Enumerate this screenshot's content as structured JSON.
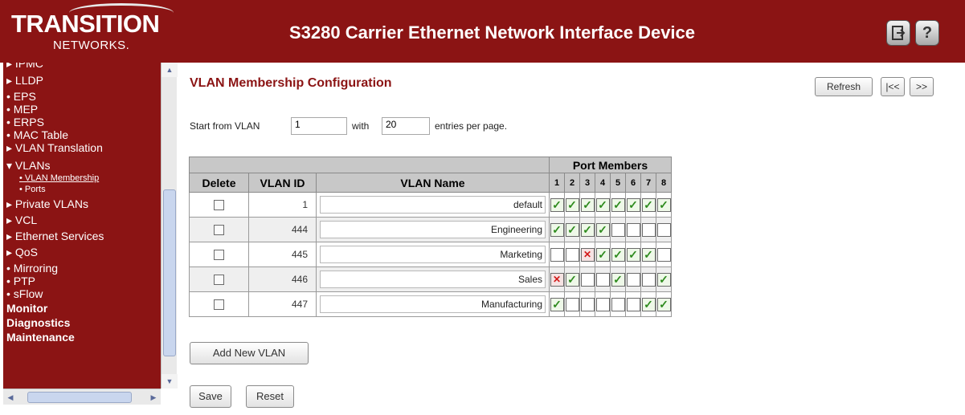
{
  "header": {
    "logo_main": "TRANSITION",
    "logo_sub": "NETWORKS.",
    "title": "S3280 Carrier Ethernet Network Interface Device",
    "logout_icon": "logout-icon",
    "help_label": "?"
  },
  "sidebar": {
    "items": [
      {
        "label": "▸ IPMC",
        "type": "partial"
      },
      {
        "label": "▸ LLDP",
        "type": "collapsed"
      },
      {
        "label": "• EPS",
        "type": "leaf"
      },
      {
        "label": "• MEP",
        "type": "leaf"
      },
      {
        "label": "• ERPS",
        "type": "leaf"
      },
      {
        "label": "• MAC Table",
        "type": "leaf"
      },
      {
        "label": "▸ VLAN Translation",
        "type": "collapsed"
      },
      {
        "label": "▾ VLANs",
        "type": "expanded"
      },
      {
        "label": "• VLAN Membership",
        "type": "sub-active"
      },
      {
        "label": "• Ports",
        "type": "sub"
      },
      {
        "label": "▸ Private VLANs",
        "type": "collapsed"
      },
      {
        "label": "▸ VCL",
        "type": "collapsed"
      },
      {
        "label": "▸ Ethernet Services",
        "type": "collapsed"
      },
      {
        "label": "▸ QoS",
        "type": "collapsed"
      },
      {
        "label": "• Mirroring",
        "type": "leaf"
      },
      {
        "label": "• PTP",
        "type": "leaf"
      },
      {
        "label": "• sFlow",
        "type": "leaf"
      },
      {
        "label": "Monitor",
        "type": "section"
      },
      {
        "label": "Diagnostics",
        "type": "section"
      },
      {
        "label": "Maintenance",
        "type": "section"
      }
    ]
  },
  "page": {
    "title": "VLAN Membership Configuration",
    "refresh_label": "Refresh",
    "first_label": "|<<",
    "next_label": ">>",
    "start_label": "Start from VLAN",
    "start_value": "1",
    "with_label": "with",
    "entries_value": "20",
    "entries_label": "entries per page."
  },
  "table": {
    "port_members_header": "Port Members",
    "col_delete": "Delete",
    "col_vlan_id": "VLAN ID",
    "col_vlan_name": "VLAN Name",
    "ports": [
      "1",
      "2",
      "3",
      "4",
      "5",
      "6",
      "7",
      "8"
    ],
    "rows": [
      {
        "id": "1",
        "name": "default",
        "ports": [
          "member",
          "member",
          "member",
          "member",
          "member",
          "member",
          "member",
          "member"
        ]
      },
      {
        "id": "444",
        "name": "Engineering",
        "ports": [
          "member",
          "member",
          "member",
          "member",
          "none",
          "none",
          "none",
          "none"
        ]
      },
      {
        "id": "445",
        "name": "Marketing",
        "ports": [
          "none",
          "none",
          "forbidden",
          "member",
          "member",
          "member",
          "member",
          "none"
        ]
      },
      {
        "id": "446",
        "name": "Sales",
        "ports": [
          "forbidden",
          "member",
          "none",
          "none",
          "member",
          "none",
          "none",
          "member"
        ]
      },
      {
        "id": "447",
        "name": "Manufacturing",
        "ports": [
          "member",
          "none",
          "none",
          "none",
          "none",
          "none",
          "member",
          "member"
        ]
      }
    ]
  },
  "actions": {
    "add_vlan_label": "Add New VLAN",
    "save_label": "Save",
    "reset_label": "Reset"
  },
  "colors": {
    "brand": "#8b1414",
    "member": "#2e8b1e",
    "forbidden": "#d21818"
  }
}
